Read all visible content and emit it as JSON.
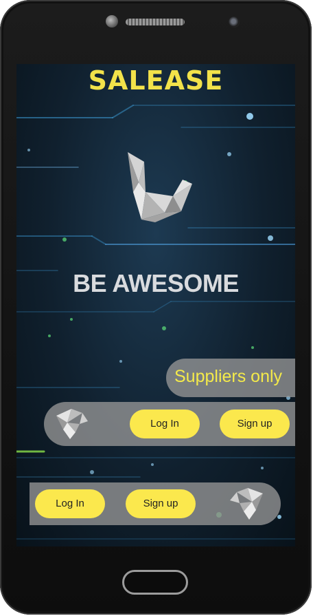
{
  "app": {
    "title": "SALEASE",
    "tagline": "BE AWESOME"
  },
  "suppliers": {
    "label": "Suppliers only",
    "login_label": "Log In",
    "signup_label": "Sign up"
  },
  "customers": {
    "login_label": "Log In",
    "signup_label": "Sign up"
  },
  "icons": {
    "logo": "origami-swan-icon",
    "suppliers_logo": "origami-swan-icon",
    "customers_logo": "origami-swan-icon"
  },
  "colors": {
    "accent": "#fbe84d",
    "title": "#f2e24a",
    "panel": "#969696",
    "background": "#10202e"
  }
}
